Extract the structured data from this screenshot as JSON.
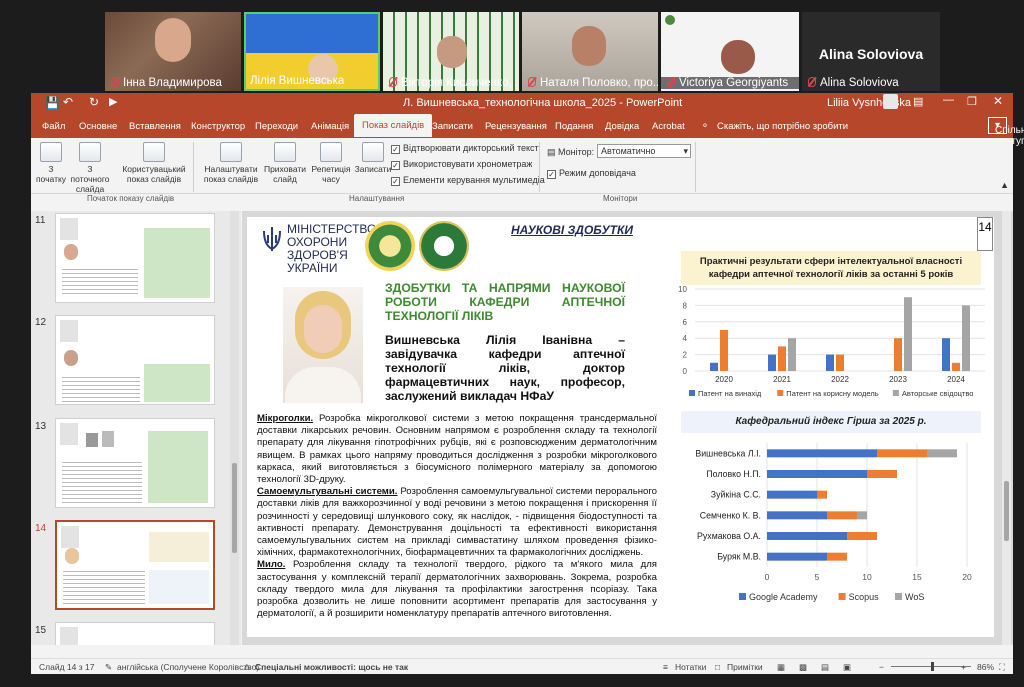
{
  "participants": [
    {
      "name": "Інна Владимирова",
      "muted": true
    },
    {
      "name": "Лілія Вишневська",
      "muted": false
    },
    {
      "name": "Вікторія Кисличенко, ...",
      "muted": true
    },
    {
      "name": "Наталя Половко, про...",
      "muted": true
    },
    {
      "name": "Victoriya Georgiyants",
      "muted": true
    },
    {
      "name": "Alina Soloviova",
      "muted": true,
      "big_name": "Alina Soloviova"
    }
  ],
  "titlebar": {
    "title": "Л. Вишневська_технологічна школа_2025 - PowerPoint",
    "user": "Liliia Vysnhevska"
  },
  "tabs": [
    "Файл",
    "Основне",
    "Вставлення",
    "Конструктор",
    "Переходи",
    "Анімація",
    "Показ слайдів",
    "Записати",
    "Рецензування",
    "Подання",
    "Довідка",
    "Acrobat"
  ],
  "active_tab": "Показ слайдів",
  "tell_me": "Скажіть, що потрібно зробити",
  "share": "Спільний доступ",
  "ribbon": {
    "btn_start": "З початку",
    "btn_current": "З поточного слайда",
    "btn_custom": "Користувацький показ слайдів",
    "grp_start": "Початок показу слайдів",
    "btn_setup": "Налаштувати показ слайдів",
    "btn_hide": "Приховати слайд",
    "btn_rehearse": "Репетиція часу",
    "btn_record": "Записати",
    "chk_narr": "Відтворювати дикторський текст",
    "chk_timing": "Використовувати хронометраж",
    "chk_media": "Елементи керування мультимедіа",
    "grp_setup": "Налаштування",
    "monitor_label": "Монітор:",
    "monitor_value": "Автоматично",
    "presenter": "Режим доповідача",
    "grp_monitors": "Монітори"
  },
  "thumbnails": [
    11,
    12,
    13,
    14,
    15
  ],
  "active_slide": 14,
  "slide": {
    "page_no": "14",
    "heading": "НАУКОВІ ЗДОБУТКИ",
    "ministry": "МІНІСТЕРСТВО ОХОРОНИ ЗДОРОВ'Я УКРАЇНИ",
    "subtitle": "ЗДОБУТКИ ТА НАПРЯМИ НАУКОВОЇ РОБОТИ КАФЕДРИ АПТЕЧНОЇ ТЕХНОЛОГІЇ ЛІКІВ",
    "person": "Вишневська Лілія Іванівна – завідувачка кафедри аптечної технології ліків, доктор фармацевтичних наук, професор, заслужений викладач НФаУ",
    "p1_title": "Мікроголки.",
    "p1": "Розробка мікроголкової системи з метою покращення трансдермальної доставки лікарських речовин. Основним напрямом є розроблення складу та технології препарату для лікування гіпотрофічних рубців, які є розповсюдженим дерматологічним явищем. В рамках цього напряму проводиться дослідження з розробки мікроголкового каркаса, який виготовляється з біосумісного полімерного матеріалу за допомогою технології 3D-друку.",
    "p2_title": "Самоемульгувальні системи.",
    "p2": "Розроблення самоемульгувальної системи перорального доставки ліків для важкорозчинної у воді речовини з метою покращення і прискорення її розчинності у середовищі шлункового соку, як наслідок, - підвищення біодоступності та активності препарату. Демонстрування доцільності та ефективності використання самоемульгувальних систем на прикладі симвастатину шляхом проведення фізико-хімічних, фармакотехнологічних, біофармацевтичних та фармакологічних досліджень.",
    "p3_title": "Мило.",
    "p3": "Розроблення складу та технології твердого, рідкого та м'якого мила для застосування у комплексній терапії дерматологічних захворювань. Зокрема, розробка складу твердого мила для лікування та профілактики загострення псоріазу. Така розробка дозволить не лише поповнити асортимент препаратів для застосування у дерматології, а й розширити номенклатуру препаратів аптечного виготовлення."
  },
  "chart_data": [
    {
      "type": "bar",
      "title": "Практичні результати сфери інтелектуальної власності кафедри аптечної технології ліків за останні 5 років",
      "categories": [
        "2020",
        "2021",
        "2022",
        "2023",
        "2024"
      ],
      "ylim": [
        0,
        10
      ],
      "yticks": [
        0,
        2,
        4,
        6,
        8,
        10
      ],
      "series": [
        {
          "name": "Патент на винахід",
          "color": "#4472c4",
          "values": [
            1,
            2,
            2,
            0,
            4
          ]
        },
        {
          "name": "Патент на корисну модель",
          "color": "#ed7d31",
          "values": [
            5,
            3,
            2,
            4,
            1
          ]
        },
        {
          "name": "Авторське свідоцтво",
          "color": "#a5a5a5",
          "values": [
            0,
            4,
            0,
            9,
            8
          ]
        }
      ],
      "grid": true,
      "legend": "bottom"
    },
    {
      "type": "bar",
      "orientation": "horizontal",
      "stacked": true,
      "title": "Кафедральний індекс Гірша за 2025 р.",
      "categories": [
        "Вишневська Л.І.",
        "Половко Н.П.",
        "Зуйкіна С.С.",
        "Семченко К. В.",
        "Рухмакова О.А.",
        "Буряк М.В."
      ],
      "xlim": [
        0,
        20
      ],
      "xticks": [
        0,
        5,
        10,
        15,
        20
      ],
      "series": [
        {
          "name": "Google Academy",
          "color": "#4472c4",
          "values": [
            11,
            10,
            5,
            6,
            8,
            6
          ]
        },
        {
          "name": "Scopus",
          "color": "#ed7d31",
          "values": [
            5,
            3,
            1,
            3,
            3,
            2
          ]
        },
        {
          "name": "WoS",
          "color": "#a5a5a5",
          "values": [
            3,
            0,
            0,
            1,
            0,
            0
          ]
        }
      ],
      "grid": true,
      "legend": "bottom"
    }
  ],
  "status": {
    "slide_info": "Слайд 14 з 17",
    "language": "англійська (Сполучене Королівство)",
    "accessibility": "Спеціальні можливості: щось не так",
    "notes": "Нотатки",
    "comments": "Примітки",
    "zoom": "86%"
  }
}
